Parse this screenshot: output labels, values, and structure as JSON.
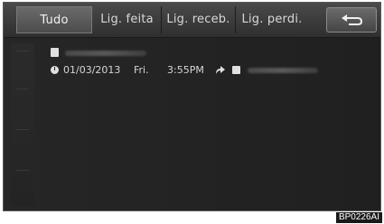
{
  "tabs": [
    {
      "label": "Tudo",
      "active": true
    },
    {
      "label": "Lig. feita",
      "active": false
    },
    {
      "label": "Lig. receb.",
      "active": false
    },
    {
      "label": "Lig. perdi.",
      "active": false
    }
  ],
  "back_button": {
    "icon": "return-arrow-icon"
  },
  "history": [
    {
      "contact_icon": "person-icon",
      "time_icon": "clock-icon",
      "date": "01/03/2013",
      "day": "Fri.",
      "time": "3:55PM",
      "call_type_icon": "outgoing-call-icon",
      "number_icon": "phone-number-icon"
    }
  ],
  "caption": "BP0226AI",
  "colors": {
    "screen_bg": "#1f1f1f",
    "tab_bar": "#3a3a3a",
    "text": "#d8d8d8"
  }
}
